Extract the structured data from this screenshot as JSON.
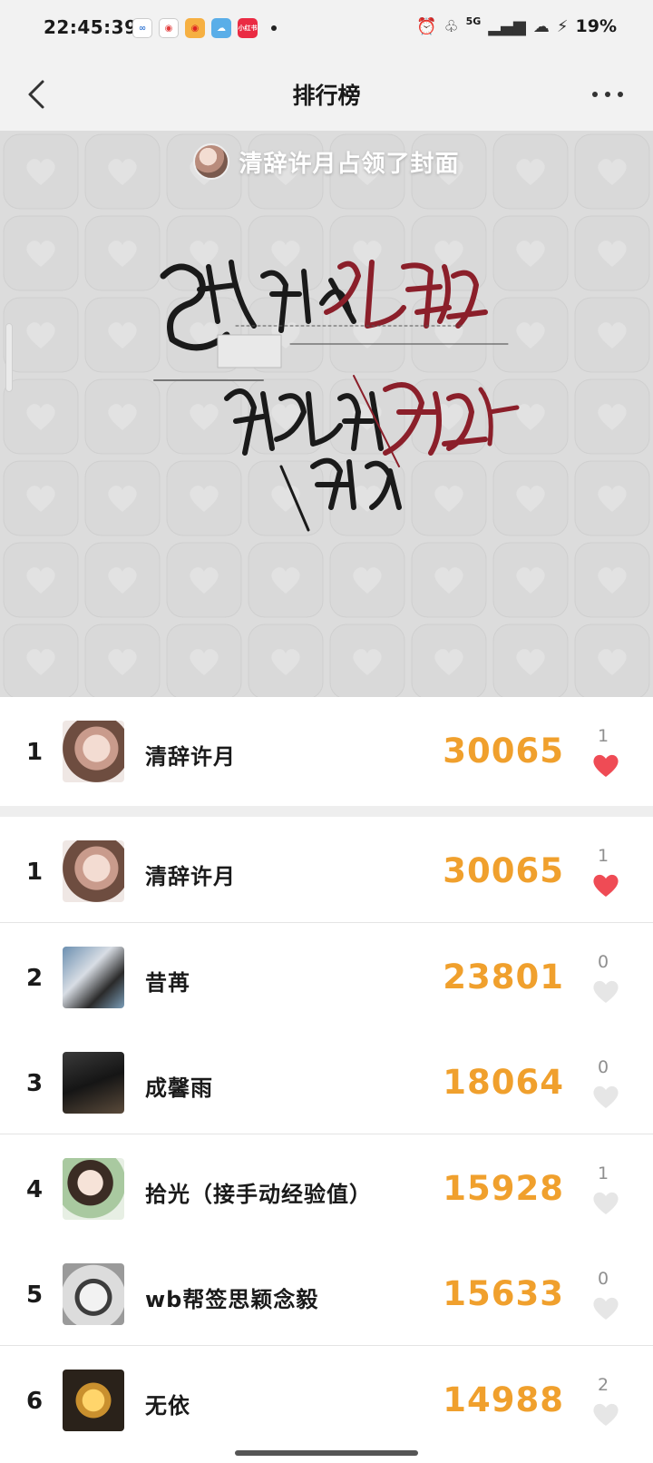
{
  "status_bar": {
    "time": "22:45:39",
    "app_icons": [
      {
        "name": "cloud-app-icon",
        "color": "#ffffff",
        "glyph": "∞"
      },
      {
        "name": "weibo-icon",
        "color": "#ffffff",
        "glyph": "◉"
      },
      {
        "name": "weibo-alt-icon",
        "color": "#f6b042",
        "glyph": "◉"
      },
      {
        "name": "weather-icon",
        "color": "#5aaee8",
        "glyph": "☁"
      },
      {
        "name": "xiaohongshu-icon",
        "color": "#ea2b43",
        "glyph": "小红书"
      }
    ],
    "network": "5G",
    "battery": "19%"
  },
  "nav": {
    "title": "排行榜"
  },
  "cover": {
    "banner_text": "清辞许月占领了封面"
  },
  "colors": {
    "score": "#f0a02d",
    "liked_heart": "#ef4b55",
    "unliked_heart": "#e6e6e6"
  },
  "pinned": {
    "rank": "1",
    "name": "清辞许月",
    "score": "30065",
    "likes": "1",
    "liked": true
  },
  "rankings": [
    {
      "rank": "1",
      "name": "清辞许月",
      "score": "30065",
      "likes": "1",
      "liked": true
    },
    {
      "rank": "2",
      "name": "昔苒",
      "score": "23801",
      "likes": "0",
      "liked": false
    },
    {
      "rank": "3",
      "name": "成馨雨",
      "score": "18064",
      "likes": "0",
      "liked": false
    },
    {
      "rank": "4",
      "name": "拾光（接手动经验值）",
      "score": "15928",
      "likes": "1",
      "liked": false
    },
    {
      "rank": "5",
      "name": "wb帮签思颖念毅",
      "score": "15633",
      "likes": "0",
      "liked": false
    },
    {
      "rank": "6",
      "name": "无依",
      "score": "14988",
      "likes": "2",
      "liked": false
    }
  ]
}
